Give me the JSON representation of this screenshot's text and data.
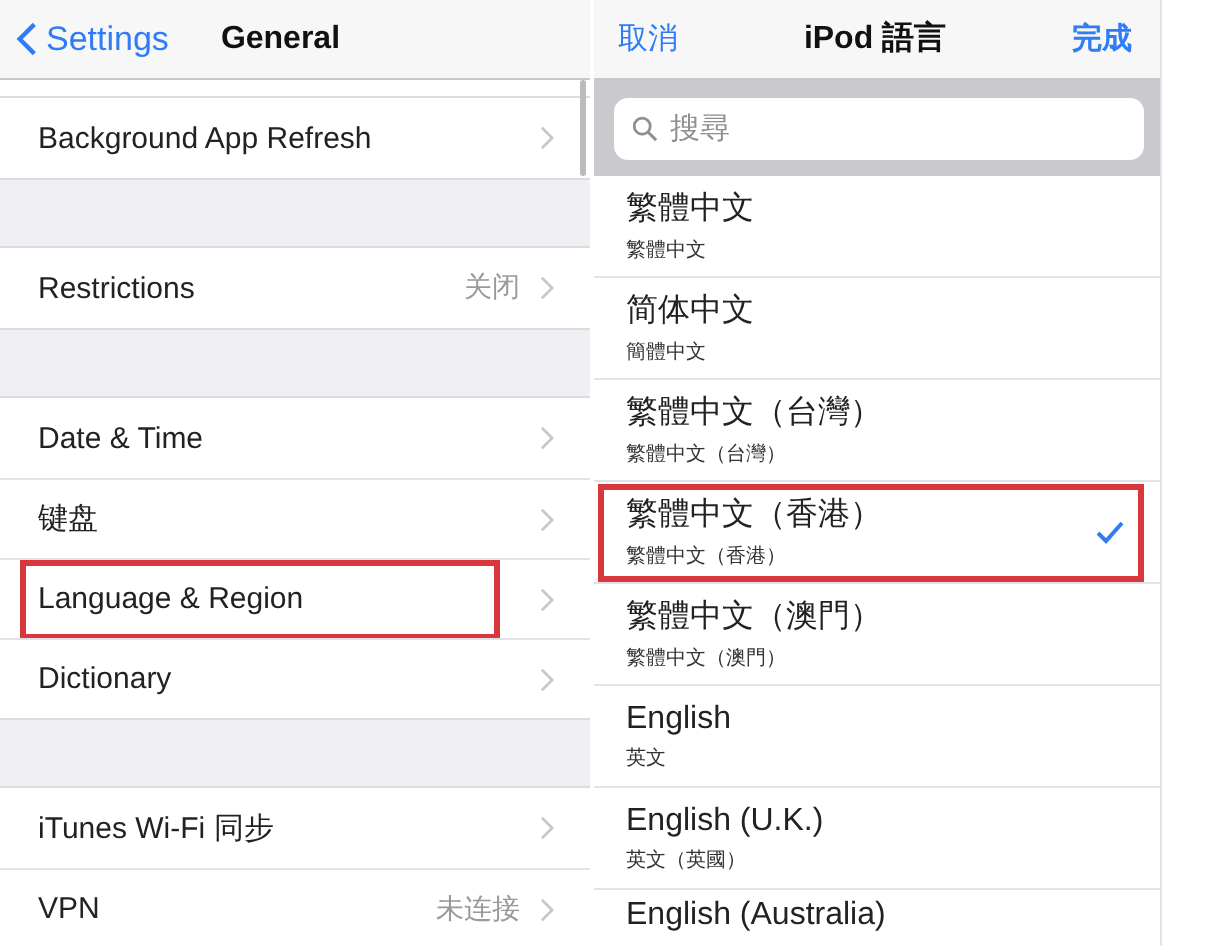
{
  "general_screen": {
    "back_button": "Settings",
    "title": "General",
    "sections": [
      {
        "rows": [
          {
            "label": "Background App Refresh",
            "highlighted": false
          }
        ]
      },
      {
        "rows": [
          {
            "label": "Restrictions",
            "value": "关闭",
            "highlighted": false
          }
        ]
      },
      {
        "rows": [
          {
            "label": "Date & Time",
            "highlighted": false
          },
          {
            "label": "键盘",
            "highlighted": false
          },
          {
            "label": "Language & Region",
            "highlighted": true
          },
          {
            "label": "Dictionary",
            "highlighted": false
          }
        ]
      },
      {
        "rows": [
          {
            "label": "iTunes Wi-Fi 同步",
            "highlighted": false
          },
          {
            "label": "VPN",
            "value": "未连接",
            "highlighted": false
          }
        ]
      }
    ]
  },
  "language_screen": {
    "cancel_button": "取消",
    "title": "iPod 語言",
    "done_button": "完成",
    "search": {
      "placeholder": "搜尋"
    },
    "languages": [
      {
        "name": "繁體中文",
        "native": "繁體中文",
        "selected": false,
        "highlighted": false
      },
      {
        "name": "简体中文",
        "native": "簡體中文",
        "selected": false,
        "highlighted": false
      },
      {
        "name": "繁體中文（台灣）",
        "native": "繁體中文（台灣）",
        "selected": false,
        "highlighted": false
      },
      {
        "name": "繁體中文（香港）",
        "native": "繁體中文（香港）",
        "selected": true,
        "highlighted": true
      },
      {
        "name": "繁體中文（澳門）",
        "native": "繁體中文（澳門）",
        "selected": false,
        "highlighted": false
      },
      {
        "name": "English",
        "native": "英文",
        "selected": false,
        "highlighted": false
      },
      {
        "name": "English (U.K.)",
        "native": "英文（英國）",
        "selected": false,
        "highlighted": false
      },
      {
        "name": "English (Australia)",
        "selected": false,
        "highlighted": false
      }
    ]
  }
}
